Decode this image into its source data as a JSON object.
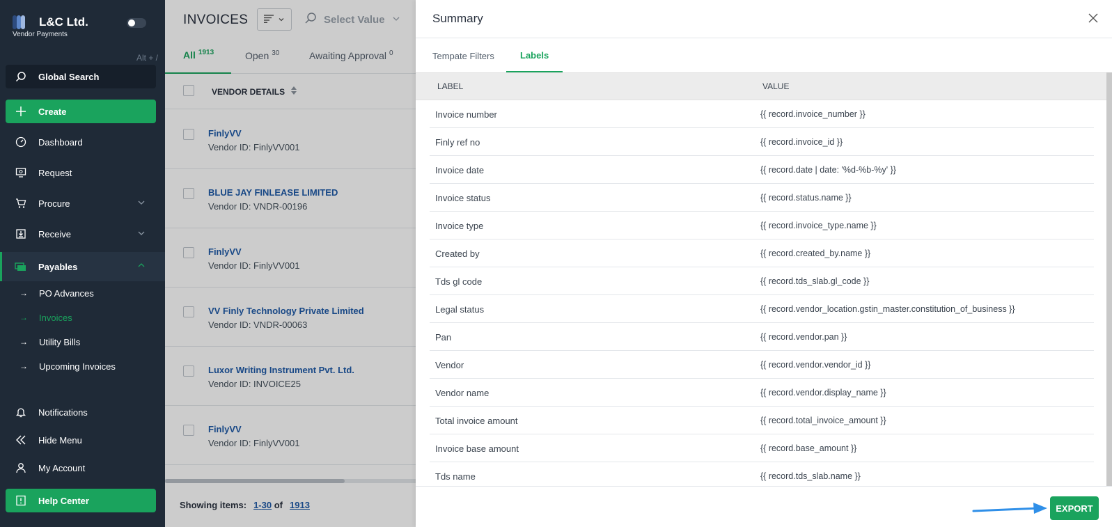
{
  "sidebar": {
    "brand_title": "L&C Ltd.",
    "brand_subtitle": "Vendor Payments",
    "shortcut_hint": "Alt + /",
    "search_label": "Global Search",
    "create_label": "Create",
    "nav": {
      "dashboard": "Dashboard",
      "request": "Request",
      "procure": "Procure",
      "receive": "Receive",
      "payables": "Payables",
      "notifications": "Notifications",
      "hide_menu": "Hide Menu",
      "my_account": "My Account",
      "help_center": "Help Center"
    },
    "payables_sub": [
      "PO Advances",
      "Invoices",
      "Utility Bills",
      "Upcoming Invoices"
    ],
    "accent_color": "#1aa35d"
  },
  "main": {
    "title": "INVOICES",
    "select_placeholder": "Select Value",
    "tabs": [
      {
        "label": "All",
        "count": "1913"
      },
      {
        "label": "Open",
        "count": "30"
      },
      {
        "label": "Awaiting Approval",
        "count": "0"
      }
    ],
    "column_header": "VENDOR DETAILS",
    "vendors": [
      {
        "name": "FinlyVV",
        "id": "Vendor ID: FinlyVV001"
      },
      {
        "name": "BLUE JAY FINLEASE LIMITED",
        "id": "Vendor ID: VNDR-00196"
      },
      {
        "name": "FinlyVV",
        "id": "Vendor ID: FinlyVV001"
      },
      {
        "name": "VV Finly Technology Private Limited",
        "id": "Vendor ID: VNDR-00063"
      },
      {
        "name": "Luxor Writing Instrument Pvt. Ltd.",
        "id": "Vendor ID: INVOICE25"
      },
      {
        "name": "FinlyVV",
        "id": "Vendor ID: FinlyVV001"
      }
    ],
    "footer": {
      "showing_label": "Showing items:",
      "range_start": "1",
      "range_sep": "-",
      "range_end": "30",
      "of_label": "of",
      "total": "1913"
    }
  },
  "summary": {
    "title": "Summary",
    "tabs": [
      "Tempate Filters",
      "Labels"
    ],
    "active_tab": "Labels",
    "headers": {
      "label": "LABEL",
      "value": "VALUE"
    },
    "rows": [
      {
        "label": "Invoice number",
        "value": "{{ record.invoice_number }}"
      },
      {
        "label": "Finly ref no",
        "value": "{{ record.invoice_id }}"
      },
      {
        "label": "Invoice date",
        "value": "{{ record.date | date: '%d-%b-%y' }}"
      },
      {
        "label": "Invoice status",
        "value": "{{ record.status.name }}"
      },
      {
        "label": "Invoice type",
        "value": "{{ record.invoice_type.name }}"
      },
      {
        "label": "Created by",
        "value": "{{ record.created_by.name }}"
      },
      {
        "label": "Tds gl code",
        "value": "{{ record.tds_slab.gl_code }}"
      },
      {
        "label": "Legal status",
        "value": "{{ record.vendor_location.gstin_master.constitution_of_business }}"
      },
      {
        "label": "Pan",
        "value": "{{ record.vendor.pan }}"
      },
      {
        "label": "Vendor",
        "value": "{{ record.vendor.vendor_id }}"
      },
      {
        "label": "Vendor name",
        "value": "{{ record.vendor.display_name }}"
      },
      {
        "label": "Total invoice amount",
        "value": "{{ record.total_invoice_amount }}"
      },
      {
        "label": "Invoice base amount",
        "value": "{{ record.base_amount }}"
      },
      {
        "label": "Tds name",
        "value": "{{ record.tds_slab.name }}"
      }
    ],
    "export_label": "EXPORT",
    "annotation_color": "#2f8fe8"
  }
}
